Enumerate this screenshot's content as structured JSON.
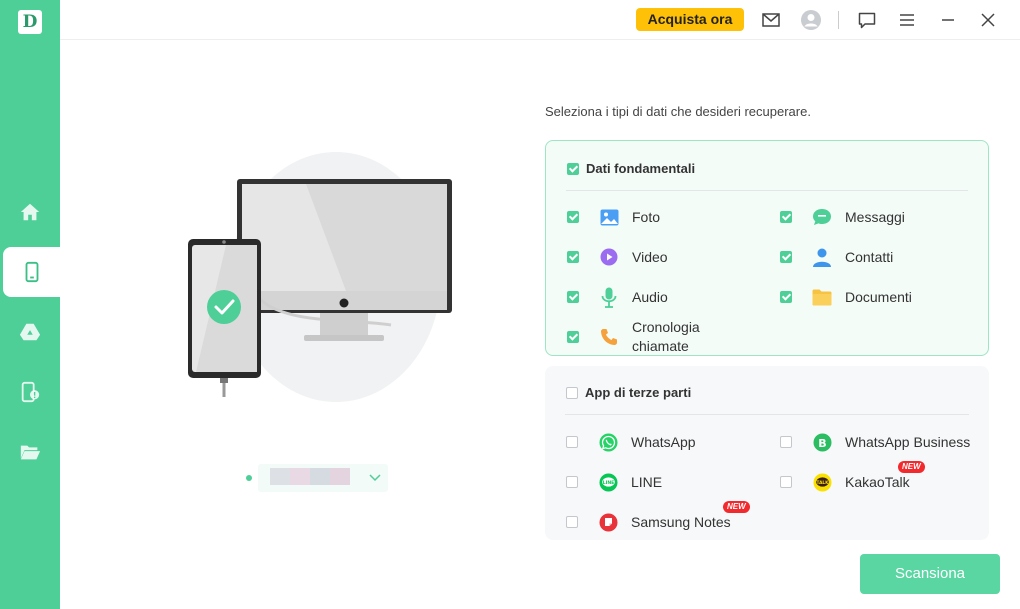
{
  "app": {
    "logo_letter": "D",
    "buy_label": "Acquista ora"
  },
  "main": {
    "instruction": "Seleziona i tipi di dati che desideri recuperare.",
    "core_section": {
      "title": "Dati fondamentali",
      "checked": true,
      "items": [
        {
          "label": "Foto",
          "checked": true,
          "icon": "photo-icon"
        },
        {
          "label": "Messaggi",
          "checked": true,
          "icon": "message-icon"
        },
        {
          "label": "Video",
          "checked": true,
          "icon": "video-icon"
        },
        {
          "label": "Contatti",
          "checked": true,
          "icon": "contact-icon"
        },
        {
          "label": "Audio",
          "checked": true,
          "icon": "microphone-icon"
        },
        {
          "label": "Documenti",
          "checked": true,
          "icon": "folder-icon"
        },
        {
          "label_line1": "Cronologia",
          "label_line2": "chiamate",
          "checked": true,
          "icon": "phone-icon"
        }
      ]
    },
    "third_party_section": {
      "title": "App di terze parti",
      "checked": false,
      "items": [
        {
          "label": "WhatsApp",
          "checked": false,
          "icon": "whatsapp-icon"
        },
        {
          "label": "WhatsApp Business",
          "checked": false,
          "icon": "whatsapp-business-icon"
        },
        {
          "label": "LINE",
          "checked": false,
          "icon": "line-icon"
        },
        {
          "label": "KakaoTalk",
          "checked": false,
          "icon": "kakaotalk-icon",
          "badge": "NEW"
        },
        {
          "label": "Samsung Notes",
          "checked": false,
          "icon": "samsung-notes-icon",
          "badge": "NEW"
        }
      ]
    },
    "scan_label": "Scansiona"
  },
  "colors": {
    "accent": "#4dcf97",
    "buy": "#ffc107",
    "badge": "#f2292d"
  }
}
